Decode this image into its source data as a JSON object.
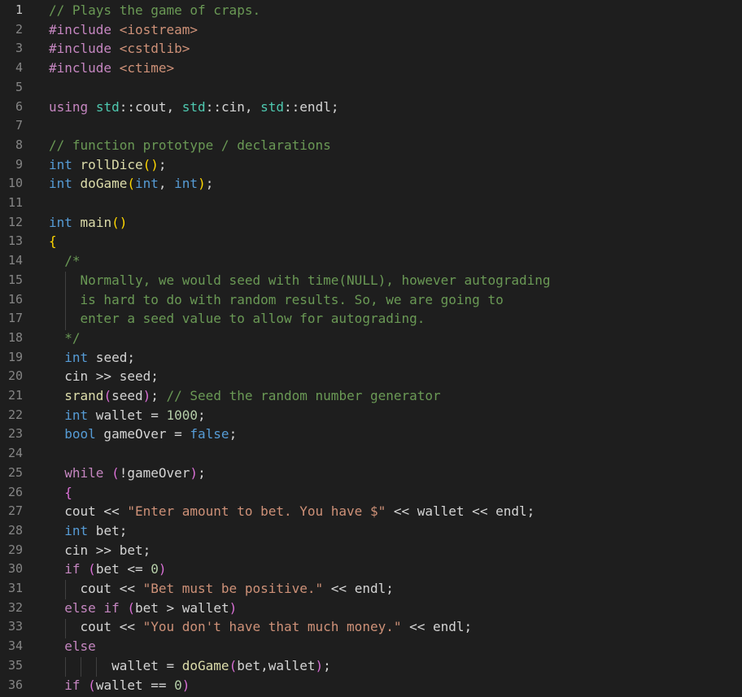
{
  "editor": {
    "language": "C++",
    "active_line": 1,
    "colors": {
      "background": "#1e1e1e",
      "comment": "#6a9955",
      "keyword": "#569cd6",
      "control": "#c586c0",
      "string": "#ce9178",
      "function": "#dcdcaa",
      "namespace": "#4ec9b0",
      "number": "#b5cea8",
      "line_number": "#858585"
    },
    "lines": [
      {
        "n": "1",
        "t": [
          [
            "cm",
            "// Plays the game of craps."
          ]
        ]
      },
      {
        "n": "2",
        "t": [
          [
            "pp",
            "#include"
          ],
          [
            "pl",
            " "
          ],
          [
            "inc",
            "<iostream>"
          ]
        ]
      },
      {
        "n": "3",
        "t": [
          [
            "pp",
            "#include"
          ],
          [
            "pl",
            " "
          ],
          [
            "inc",
            "<cstdlib>"
          ]
        ]
      },
      {
        "n": "4",
        "t": [
          [
            "pp",
            "#include"
          ],
          [
            "pl",
            " "
          ],
          [
            "inc",
            "<ctime>"
          ]
        ]
      },
      {
        "n": "5",
        "t": []
      },
      {
        "n": "6",
        "t": [
          [
            "ctl",
            "using"
          ],
          [
            "pl",
            " "
          ],
          [
            "ns",
            "std"
          ],
          [
            "pl",
            "::cout, "
          ],
          [
            "ns",
            "std"
          ],
          [
            "pl",
            "::cin, "
          ],
          [
            "ns",
            "std"
          ],
          [
            "pl",
            "::endl;"
          ]
        ]
      },
      {
        "n": "7",
        "t": []
      },
      {
        "n": "8",
        "t": [
          [
            "cm",
            "// function prototype / declarations"
          ]
        ]
      },
      {
        "n": "9",
        "t": [
          [
            "kw",
            "int"
          ],
          [
            "pl",
            " "
          ],
          [
            "fn",
            "rollDice"
          ],
          [
            "p1",
            "()"
          ],
          [
            "pl",
            ";"
          ]
        ]
      },
      {
        "n": "10",
        "t": [
          [
            "kw",
            "int"
          ],
          [
            "pl",
            " "
          ],
          [
            "fn",
            "doGame"
          ],
          [
            "p1",
            "("
          ],
          [
            "kw",
            "int"
          ],
          [
            "pl",
            ", "
          ],
          [
            "kw",
            "int"
          ],
          [
            "p1",
            ")"
          ],
          [
            "pl",
            ";"
          ]
        ]
      },
      {
        "n": "11",
        "t": []
      },
      {
        "n": "12",
        "t": [
          [
            "kw",
            "int"
          ],
          [
            "pl",
            " "
          ],
          [
            "fn",
            "main"
          ],
          [
            "p1",
            "()"
          ]
        ]
      },
      {
        "n": "13",
        "t": [
          [
            "p1",
            "{"
          ]
        ]
      },
      {
        "n": "14",
        "t": [
          [
            "pl",
            "  "
          ],
          [
            "cm",
            "/*"
          ]
        ]
      },
      {
        "n": "15",
        "t": [
          [
            "pl",
            "    "
          ],
          [
            "cm",
            "Normally, we would seed with time(NULL), however autograding"
          ]
        ]
      },
      {
        "n": "16",
        "t": [
          [
            "pl",
            "    "
          ],
          [
            "cm",
            "is hard to do with random results. So, we are going to"
          ]
        ]
      },
      {
        "n": "17",
        "t": [
          [
            "pl",
            "    "
          ],
          [
            "cm",
            "enter a seed value to allow for autograding."
          ]
        ]
      },
      {
        "n": "18",
        "t": [
          [
            "pl",
            "  "
          ],
          [
            "cm",
            "*/"
          ]
        ]
      },
      {
        "n": "19",
        "t": [
          [
            "pl",
            "  "
          ],
          [
            "kw",
            "int"
          ],
          [
            "pl",
            " seed;"
          ]
        ]
      },
      {
        "n": "20",
        "t": [
          [
            "pl",
            "  cin >> seed;"
          ]
        ]
      },
      {
        "n": "21",
        "t": [
          [
            "pl",
            "  "
          ],
          [
            "fn",
            "srand"
          ],
          [
            "p2",
            "("
          ],
          [
            "pl",
            "seed"
          ],
          [
            "p2",
            ")"
          ],
          [
            "pl",
            "; "
          ],
          [
            "cm",
            "// Seed the random number generator"
          ]
        ]
      },
      {
        "n": "22",
        "t": [
          [
            "pl",
            "  "
          ],
          [
            "kw",
            "int"
          ],
          [
            "pl",
            " wallet = "
          ],
          [
            "num",
            "1000"
          ],
          [
            "pl",
            ";"
          ]
        ]
      },
      {
        "n": "23",
        "t": [
          [
            "pl",
            "  "
          ],
          [
            "kw",
            "bool"
          ],
          [
            "pl",
            " gameOver = "
          ],
          [
            "kw",
            "false"
          ],
          [
            "pl",
            ";"
          ]
        ]
      },
      {
        "n": "24",
        "t": []
      },
      {
        "n": "25",
        "t": [
          [
            "pl",
            "  "
          ],
          [
            "ctl",
            "while"
          ],
          [
            "pl",
            " "
          ],
          [
            "p2",
            "("
          ],
          [
            "pl",
            "!gameOver"
          ],
          [
            "p2",
            ")"
          ],
          [
            "pl",
            ";"
          ]
        ]
      },
      {
        "n": "26",
        "t": [
          [
            "pl",
            "  "
          ],
          [
            "p2",
            "{"
          ]
        ]
      },
      {
        "n": "27",
        "t": [
          [
            "pl",
            "  cout << "
          ],
          [
            "str",
            "\"Enter amount to bet. You have $\""
          ],
          [
            "pl",
            " << wallet << endl;"
          ]
        ]
      },
      {
        "n": "28",
        "t": [
          [
            "pl",
            "  "
          ],
          [
            "kw",
            "int"
          ],
          [
            "pl",
            " bet;"
          ]
        ]
      },
      {
        "n": "29",
        "t": [
          [
            "pl",
            "  cin >> bet;"
          ]
        ]
      },
      {
        "n": "30",
        "t": [
          [
            "pl",
            "  "
          ],
          [
            "ctl",
            "if"
          ],
          [
            "pl",
            " "
          ],
          [
            "p2",
            "("
          ],
          [
            "pl",
            "bet <= "
          ],
          [
            "num",
            "0"
          ],
          [
            "p2",
            ")"
          ]
        ]
      },
      {
        "n": "31",
        "t": [
          [
            "pl",
            "    cout << "
          ],
          [
            "str",
            "\"Bet must be positive.\""
          ],
          [
            "pl",
            " << endl;"
          ]
        ]
      },
      {
        "n": "32",
        "t": [
          [
            "pl",
            "  "
          ],
          [
            "ctl",
            "else"
          ],
          [
            "pl",
            " "
          ],
          [
            "ctl",
            "if"
          ],
          [
            "pl",
            " "
          ],
          [
            "p2",
            "("
          ],
          [
            "pl",
            "bet > wallet"
          ],
          [
            "p2",
            ")"
          ]
        ]
      },
      {
        "n": "33",
        "t": [
          [
            "pl",
            "    cout << "
          ],
          [
            "str",
            "\"You don't have that much money.\""
          ],
          [
            "pl",
            " << endl;"
          ]
        ]
      },
      {
        "n": "34",
        "t": [
          [
            "pl",
            "  "
          ],
          [
            "ctl",
            "else"
          ]
        ]
      },
      {
        "n": "35",
        "t": [
          [
            "pl",
            "        wallet = "
          ],
          [
            "fn",
            "doGame"
          ],
          [
            "p2",
            "("
          ],
          [
            "pl",
            "bet,wallet"
          ],
          [
            "p2",
            ")"
          ],
          [
            "pl",
            ";"
          ]
        ]
      },
      {
        "n": "36",
        "t": [
          [
            "pl",
            "  "
          ],
          [
            "ctl",
            "if"
          ],
          [
            "pl",
            " "
          ],
          [
            "p2",
            "("
          ],
          [
            "pl",
            "wallet == "
          ],
          [
            "num",
            "0"
          ],
          [
            "p2",
            ")"
          ]
        ]
      }
    ]
  }
}
